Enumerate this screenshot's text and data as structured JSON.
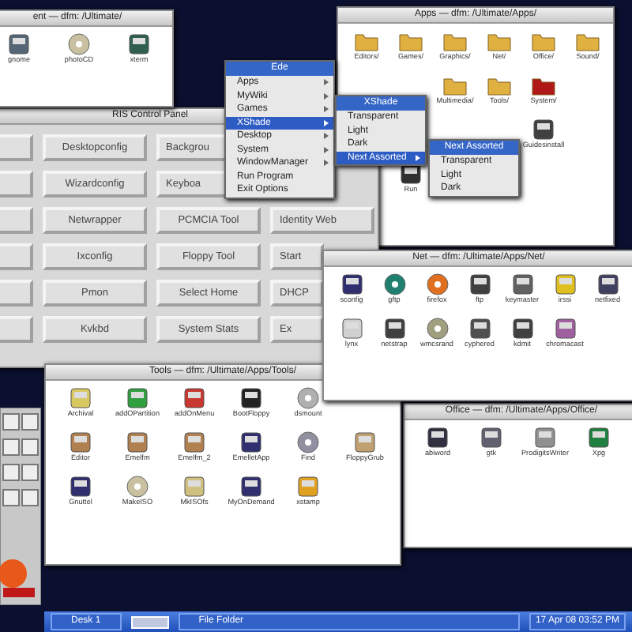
{
  "windows": [
    {
      "kind": "files",
      "title": "Net — dfm: /Ultimate/Apps/Net/",
      "icons": [
        {
          "label": "sconfig",
          "kind": "app",
          "color": "#303070"
        },
        {
          "label": "gftp",
          "kind": "disc",
          "color": "#208070"
        },
        {
          "label": "firefox",
          "kind": "disc",
          "color": "#e07020"
        },
        {
          "label": "ftp",
          "kind": "app",
          "color": "#404040"
        },
        {
          "label": "keymaster",
          "kind": "app",
          "color": "#606060"
        },
        {
          "label": "irssi",
          "kind": "app",
          "color": "#e0c020"
        },
        {
          "label": "netfixed",
          "kind": "app",
          "color": "#404060"
        },
        {
          "label": "lynx",
          "kind": "app",
          "color": "#d0d0d0"
        },
        {
          "label": "netstrap",
          "kind": "app",
          "color": "#404040"
        },
        {
          "label": "wmcsrand",
          "kind": "disc",
          "color": "#a0a080"
        },
        {
          "label": "cyphered",
          "kind": "app",
          "color": "#505050"
        },
        {
          "label": "kdmit",
          "kind": "app",
          "color": "#404040"
        },
        {
          "label": "chromacast",
          "kind": "app",
          "color": "#a060a0"
        }
      ]
    },
    {
      "kind": "files",
      "title": "Tools — dfm: /Ultimate/Apps/Tools/",
      "icons": [
        {
          "label": "Archival",
          "kind": "app",
          "color": "#d8c860"
        },
        {
          "label": "addOPartition",
          "kind": "app",
          "color": "#2f9f3f"
        },
        {
          "label": "addOnMenu",
          "kind": "app",
          "color": "#c83830"
        },
        {
          "label": "BootFloppy",
          "kind": "app",
          "color": "#222222"
        },
        {
          "label": "dsmount",
          "kind": "disc",
          "color": "#b0b0b0"
        },
        {
          "label": "Editor",
          "kind": "app",
          "color": "#b08050"
        },
        {
          "label": "Emelfm",
          "kind": "app",
          "color": "#b08050"
        },
        {
          "label": "Emelfm_2",
          "kind": "app",
          "color": "#b08050"
        },
        {
          "label": "EmelletApp",
          "kind": "app",
          "color": "#303070"
        },
        {
          "label": "Find",
          "kind": "disc",
          "color": "#9090a0"
        },
        {
          "label": "FloppyGrub",
          "kind": "app",
          "color": "#c0a070"
        },
        {
          "label": "Gnuttel",
          "kind": "app",
          "color": "#303070"
        },
        {
          "label": "MakeISO",
          "kind": "disc",
          "color": "#c8c0a0"
        },
        {
          "label": "MkISOfs",
          "kind": "app",
          "color": "#d0c080"
        },
        {
          "label": "MyOnDemand",
          "kind": "app",
          "color": "#303070"
        },
        {
          "label": "xstamp",
          "kind": "app",
          "color": "#e0a020"
        }
      ]
    },
    {
      "kind": "files",
      "title": "Office — dfm: /Ultimate/Apps/Office/",
      "icons": [
        {
          "label": "abiword",
          "kind": "app",
          "color": "#303040"
        },
        {
          "label": "gtk",
          "kind": "app",
          "color": "#606070"
        },
        {
          "label": "ProdigitsWriter",
          "kind": "app",
          "color": "#909090"
        },
        {
          "label": "Xpg",
          "kind": "app",
          "color": "#208040"
        }
      ]
    },
    {
      "kind": "files",
      "title": "ent — dfm: /Ultimate/",
      "icons": [
        {
          "label": "gnome",
          "kind": "app",
          "color": "#556677"
        },
        {
          "label": "photoCD",
          "kind": "disc",
          "color": "#c8c0a0"
        },
        {
          "label": "xterm",
          "kind": "app",
          "color": "#2f5f4f"
        }
      ]
    },
    {
      "kind": "panel",
      "title": "RIS Control Panel",
      "rows": [
        [
          "Desktopconfig",
          "Backgrou"
        ],
        [
          "Wizardconfig",
          "Keyboa"
        ],
        [
          "Netwrapper",
          "PCMCIA Tool",
          "Identity Web"
        ],
        [
          "Ixconfig",
          "Floppy Tool",
          "Start"
        ],
        [
          "Pmon",
          "Select Home",
          "DHCP"
        ],
        [
          "Kvkbd",
          "System Stats",
          "Ex"
        ]
      ]
    },
    {
      "kind": "files",
      "title": "Apps — dfm: /Ultimate/Apps/",
      "icons": [
        {
          "label": "Editors/",
          "kind": "folder",
          "color": "#e0b040"
        },
        {
          "label": "Games/",
          "kind": "folder",
          "color": "#e0b040"
        },
        {
          "label": "Graphics/",
          "kind": "folder",
          "color": "#e0b040"
        },
        {
          "label": "Net/",
          "kind": "folder",
          "color": "#e0b040"
        },
        {
          "label": "Office/",
          "kind": "folder",
          "color": "#e0b040"
        },
        {
          "label": "Sound/",
          "kind": "folder",
          "color": "#e0b040"
        },
        {
          "label": "Multimedia/",
          "kind": "folder",
          "color": "#e0b040"
        },
        {
          "label": "Tools/",
          "kind": "folder",
          "color": "#e0b040"
        },
        {
          "label": "System/",
          "kind": "folder",
          "color": "#b01818"
        },
        {
          "label": "Guidesinstall",
          "kind": "app",
          "color": "#404040"
        },
        {
          "label": "Run",
          "kind": "app",
          "color": "#303030"
        }
      ]
    }
  ],
  "menus": [
    {
      "title": "Ede",
      "items": [
        {
          "label": "Apps",
          "submenu": true,
          "selected": false
        },
        {
          "label": "MyWiki",
          "submenu": true,
          "selected": false
        },
        {
          "label": "Games",
          "submenu": true,
          "selected": false
        },
        {
          "label": "XShade",
          "submenu": true,
          "selected": true
        },
        {
          "label": "Desktop",
          "submenu": true,
          "selected": false
        },
        {
          "label": "System",
          "submenu": true,
          "selected": false
        },
        {
          "label": "WindowManager",
          "submenu": true,
          "selected": false
        },
        {
          "label": "Run Program",
          "submenu": false,
          "selected": false
        },
        {
          "label": "Exit Options",
          "submenu": false,
          "selected": false
        }
      ]
    },
    {
      "title": "XShade",
      "items": [
        {
          "label": "Transparent",
          "submenu": false,
          "selected": false
        },
        {
          "label": "Light",
          "submenu": false,
          "selected": false
        },
        {
          "label": "Dark",
          "submenu": false,
          "selected": false
        },
        {
          "label": "Next Assorted",
          "submenu": true,
          "selected": true
        }
      ]
    },
    {
      "title": "Next Assorted",
      "items": [
        {
          "label": "Transparent",
          "submenu": false,
          "selected": false
        },
        {
          "label": "Light",
          "submenu": false,
          "selected": false
        },
        {
          "label": "Dark",
          "submenu": false,
          "selected": false
        }
      ]
    }
  ],
  "taskbar": {
    "desk": "Desk 1",
    "task": "File Folder",
    "clock": "17 Apr 08 03:52 PM"
  }
}
